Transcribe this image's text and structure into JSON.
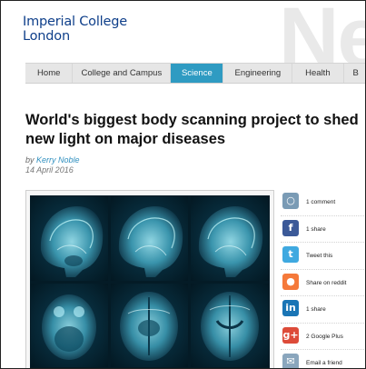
{
  "header": {
    "logo_line1": "Imperial College",
    "logo_line2": "London",
    "watermark": "Ne"
  },
  "nav": {
    "tabs": [
      {
        "label": "Home"
      },
      {
        "label": "College and Campus"
      },
      {
        "label": "Science",
        "active": true
      },
      {
        "label": "Engineering"
      },
      {
        "label": "Health"
      },
      {
        "label": "B"
      }
    ]
  },
  "article": {
    "headline_line1": "World's biggest body scanning project to shed",
    "headline_line2": "new light on major diseases",
    "byline_prefix": "by",
    "author": "Kerry Noble",
    "date": "14 April 2016",
    "image_icon": "brain-mri-scans-image"
  },
  "share": {
    "items": [
      {
        "label": "1 comment",
        "icon": "comment-icon",
        "color": "#7a9bb5"
      },
      {
        "label": "1 share",
        "icon": "facebook-icon",
        "color": "#3b5998"
      },
      {
        "label": "Tweet this",
        "icon": "twitter-icon",
        "color": "#3fa9e0"
      },
      {
        "label": "Share on reddit",
        "icon": "reddit-icon",
        "color": "#f5793a"
      },
      {
        "label": "1 share",
        "icon": "linkedin-icon",
        "color": "#1a75b5"
      },
      {
        "label": "2 Google Plus",
        "icon": "google-plus-icon",
        "color": "#dd4b39"
      },
      {
        "label": "Email a friend",
        "icon": "email-icon",
        "color": "#8aa6bd"
      }
    ]
  }
}
